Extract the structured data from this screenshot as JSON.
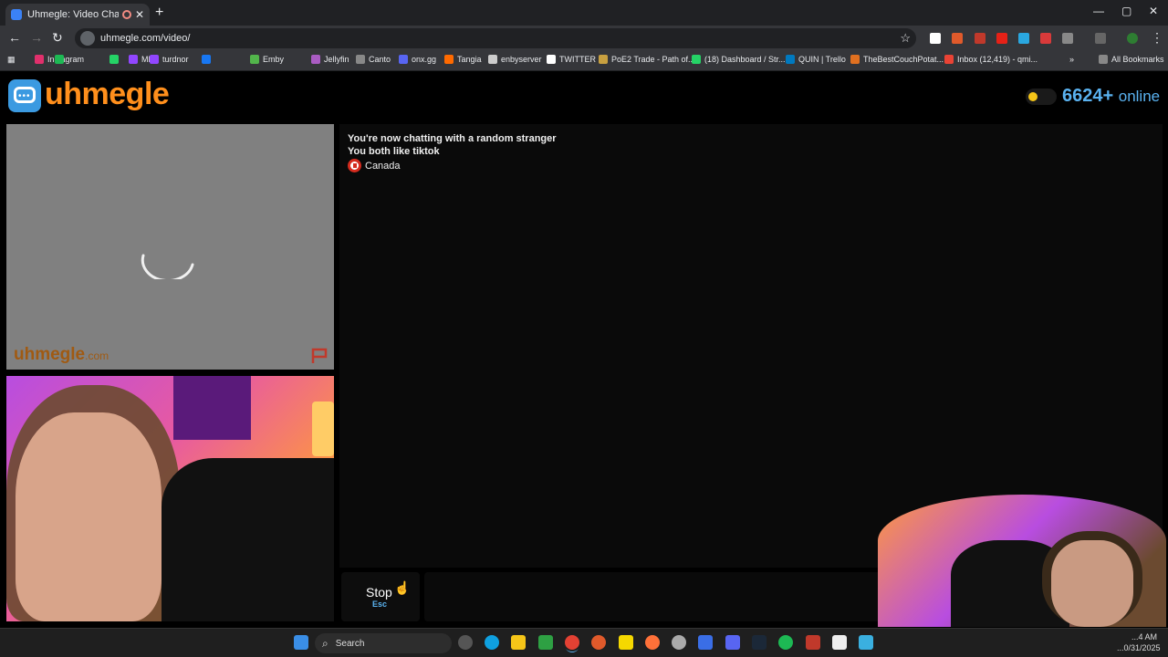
{
  "browser": {
    "tab_title": "Uhmegle: Video Chat | Random",
    "tab_close": "✕",
    "new_tab": "+",
    "window_controls": {
      "minimize": "—",
      "maximize": "▢",
      "close": "✕"
    },
    "url": "uhmegle.com/video/",
    "bookmarks": [
      {
        "label": "Instagram",
        "color": "#e1306c"
      },
      {
        "label": "",
        "color": "#1db954"
      },
      {
        "label": "",
        "color": "#25d366"
      },
      {
        "label": "ME",
        "color": "#9146ff"
      },
      {
        "label": "turdnor",
        "color": "#9146ff"
      },
      {
        "label": "",
        "color": "#1877f2"
      },
      {
        "label": "Emby",
        "color": "#52b54b"
      },
      {
        "label": "Jellyfin",
        "color": "#aa5cc3"
      },
      {
        "label": "Canto",
        "color": "#888888"
      },
      {
        "label": "onx.gg",
        "color": "#5865f2"
      },
      {
        "label": "Tangia",
        "color": "#ff6a00"
      },
      {
        "label": "enbyserver",
        "color": "#cccccc"
      },
      {
        "label": "TWITTER",
        "color": "#ffffff"
      },
      {
        "label": "PoE2 Trade - Path of...",
        "color": "#c8a040"
      },
      {
        "label": "(18) Dashboard / Str...",
        "color": "#25d366"
      },
      {
        "label": "QUIN | Trello",
        "color": "#0079bf"
      },
      {
        "label": "TheBestCouchPotat...",
        "color": "#e07020"
      },
      {
        "label": "Inbox (12,419) - qmi...",
        "color": "#ea4335"
      }
    ],
    "all_bookmarks": "All Bookmarks"
  },
  "site": {
    "logo_text": "uhmegle",
    "online_count": "6624+",
    "online_label": "online",
    "watermark": "uhmegle",
    "watermark_domain": ".com",
    "messages": [
      "You're now chatting with a random stranger",
      "You both like tiktok"
    ],
    "country": "Canada",
    "stop_label": "Stop",
    "stop_key": "Esc"
  },
  "taskbar": {
    "search_label": "Search",
    "clock_time": "...4 AM",
    "clock_date": "...0/31/2025"
  }
}
